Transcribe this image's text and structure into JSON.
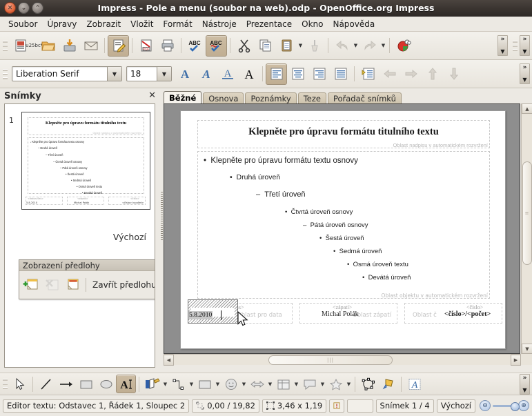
{
  "window": {
    "title": "Impress - Pole a menu (soubor na web).odp - OpenOffice.org Impress",
    "close_glyph": "✕",
    "minimize_glyph": "⌄",
    "maximize_glyph": "⌃"
  },
  "menubar": {
    "items": [
      {
        "label": "Soubor"
      },
      {
        "label": "Úpravy"
      },
      {
        "label": "Zobrazit"
      },
      {
        "label": "Vložit"
      },
      {
        "label": "Formát"
      },
      {
        "label": "Nástroje"
      },
      {
        "label": "Prezentace"
      },
      {
        "label": "Okno"
      },
      {
        "label": "Nápověda"
      }
    ]
  },
  "standard_toolbar": {
    "buttons": [
      {
        "name": "new-document",
        "title": "Nový"
      },
      {
        "name": "open-document",
        "title": "Otevřít"
      },
      {
        "name": "save-document",
        "title": "Uložit"
      },
      {
        "name": "email-document",
        "title": "Dokument jako e-mail"
      },
      {
        "name": "edit-file",
        "title": "Upravit soubor",
        "active": true
      },
      {
        "name": "export-pdf",
        "title": "Export do PDF"
      },
      {
        "name": "print-document",
        "title": "Tisk"
      },
      {
        "name": "spelling-check",
        "title": "Kontrola pravopisu"
      },
      {
        "name": "autospellcheck",
        "title": "Automatická kontrola pravopisu",
        "active": true
      },
      {
        "name": "cut",
        "title": "Vyjmout"
      },
      {
        "name": "copy",
        "title": "Kopírovat"
      },
      {
        "name": "paste",
        "title": "Vložit"
      },
      {
        "name": "clone-formatting",
        "title": "Klonovat formátování"
      },
      {
        "name": "undo",
        "title": "Zpět"
      },
      {
        "name": "redo",
        "title": "Znovu"
      },
      {
        "name": "chart",
        "title": "Graf"
      }
    ],
    "overflow_glyph": "»"
  },
  "formatting_toolbar": {
    "font_name": "Liberation Serif",
    "font_size": "18",
    "dropdown_glyph": "▼",
    "buttons": [
      {
        "name": "bold",
        "label": "A"
      },
      {
        "name": "italic",
        "label": "A"
      },
      {
        "name": "underline",
        "label": "A"
      },
      {
        "name": "font-color",
        "label": "A"
      },
      {
        "name": "align-left",
        "active": true
      },
      {
        "name": "align-center"
      },
      {
        "name": "align-right"
      },
      {
        "name": "align-justified"
      },
      {
        "name": "bullets-numbering"
      },
      {
        "name": "promote-left"
      },
      {
        "name": "demote-right"
      },
      {
        "name": "move-up"
      },
      {
        "name": "move-down"
      }
    ],
    "overflow_glyph": "»"
  },
  "slide_pane": {
    "title": "Snímky",
    "close_glyph": "✕",
    "slide_number": "1",
    "master_name": "Výchozí",
    "thumbnail": {
      "title": "Klepněte pro úpravu formátu titulního textu",
      "title_hint": "Oblast nadpisu v automatickém rozvržení",
      "outline": [
        "Klepněte pro úpravu formátu textu osnovy",
        "Druhá úroveň",
        "Třetí úroveň",
        "Čtvrtá úroveň osnovy",
        "Pátá úroveň osnovy",
        "Šestá úroveň",
        "Sedmá úroveň",
        "Osmá úroveň textu",
        "Devátá úroveň"
      ],
      "footer_left_hint": "<datum/čas>",
      "footer_left_value": "5.8.2010",
      "footer_left_area": "Oblast pro data",
      "footer_center_hint": "<zápatí>",
      "footer_center_value": "Michal Polák",
      "footer_center_area": "Oblast zápatí",
      "footer_right_hint": "<číslo>",
      "footer_right_value": "<číslo>/<počet>",
      "footer_right_area": "Oblast č"
    }
  },
  "master_toolbar": {
    "title": "Zobrazení předlohy",
    "dropdown_glyph": "▼",
    "close_label": "Zavřít předlohu",
    "buttons": [
      {
        "name": "new-master",
        "enabled": true
      },
      {
        "name": "delete-master",
        "enabled": false
      },
      {
        "name": "rename-master",
        "enabled": true
      }
    ]
  },
  "view_tabs": {
    "items": [
      {
        "label": "Běžné",
        "selected": true
      },
      {
        "label": "Osnova",
        "selected": false
      },
      {
        "label": "Poznámky",
        "selected": false
      },
      {
        "label": "Teze",
        "selected": false
      },
      {
        "label": "Pořadač snímků",
        "selected": false
      }
    ]
  },
  "slide": {
    "title": "Klepněte pro úpravu formátu titulního textu",
    "title_hint": "Oblast nadpisu v automatickém rozvržení",
    "outline_hint": "Oblast objektu v automatickém rozvržení",
    "outline": [
      {
        "level": 1,
        "bullet": "•",
        "text": "Klepněte pro úpravu formátu textu osnovy"
      },
      {
        "level": 2,
        "bullet": "•",
        "text": "Druhá úroveň"
      },
      {
        "level": 3,
        "bullet": "–",
        "text": "Třetí úroveň"
      },
      {
        "level": 4,
        "bullet": "•",
        "text": "Čtvrtá úroveň osnovy"
      },
      {
        "level": 5,
        "bullet": "–",
        "text": "Pátá úroveň osnovy"
      },
      {
        "level": 6,
        "bullet": "•",
        "text": "Šestá úroveň"
      },
      {
        "level": 7,
        "bullet": "•",
        "text": "Sedmá úroveň"
      },
      {
        "level": 8,
        "bullet": "•",
        "text": "Osmá úroveň textu"
      },
      {
        "level": 9,
        "bullet": "•",
        "text": "Devátá úroveň"
      }
    ],
    "footer": {
      "date_placeholder": "<datum/čas>",
      "date_value": "5.8.2010",
      "date_area_label": "Oblast pro data",
      "footer_placeholder": "<zápatí>",
      "footer_value": "Michal Polák",
      "footer_area_label": "Oblast zápatí",
      "number_placeholder": "<číslo>",
      "number_value": "<číslo>/<počet>",
      "number_area_label": "Oblast č"
    }
  },
  "draw_toolbar": {
    "buttons": [
      {
        "name": "select",
        "title": "Výběr"
      },
      {
        "name": "line",
        "title": "Čára"
      },
      {
        "name": "arrow-line",
        "title": "Čára zakončená šipkou"
      },
      {
        "name": "rectangle",
        "title": "Obdélník"
      },
      {
        "name": "ellipse",
        "title": "Elipsa"
      },
      {
        "name": "text-tool",
        "title": "Textové pole",
        "active": true
      },
      {
        "name": "curve",
        "title": "Křivka"
      },
      {
        "name": "connector",
        "title": "Spojnice"
      },
      {
        "name": "basic-shapes",
        "title": "Základní tvary"
      },
      {
        "name": "symbol-shapes",
        "title": "Symboly"
      },
      {
        "name": "block-arrows",
        "title": "Blokové šipky"
      },
      {
        "name": "flowchart",
        "title": "Vyžadávací diagramy"
      },
      {
        "name": "callouts",
        "title": "Bubliny"
      },
      {
        "name": "stars",
        "title": "Hvězdy"
      },
      {
        "name": "points",
        "title": "Body"
      },
      {
        "name": "glue-points",
        "title": "Body lepidla"
      },
      {
        "name": "fontwork",
        "title": "Galerie Fontwork"
      }
    ],
    "overflow_glyph": "»"
  },
  "statusbar": {
    "text_editor": "Editor textu: Odstavec 1, Řádek 1, Sloupec 2",
    "position": "0,00 / 19,82",
    "size": "3,46 x 1,19",
    "modified_glyph": "!",
    "slide_count": "Snímek 1 / 4",
    "master": "Výchozí",
    "zoom_out_glyph": "⊖",
    "zoom_in_glyph": "⊕"
  },
  "scrollbars": {
    "up_glyph": "▲",
    "down_glyph": "▼",
    "left_glyph": "◀",
    "right_glyph": "▶",
    "grip_glyph": "≡"
  },
  "colors": {
    "titlebar": "#3a3430",
    "chrome": "#ece9e3",
    "active_tool": "#c0ae92",
    "canvas": "#8e8e8e"
  }
}
